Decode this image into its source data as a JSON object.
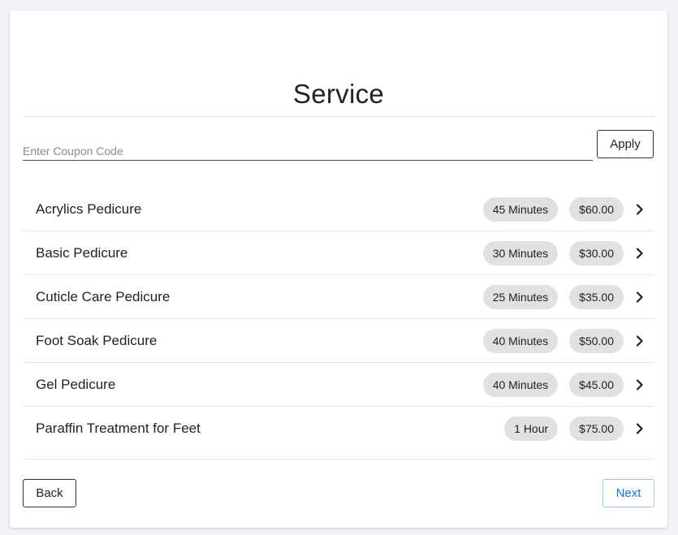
{
  "header": {
    "title": "Service"
  },
  "coupon": {
    "placeholder": "Enter Coupon Code",
    "value": "",
    "apply_label": "Apply"
  },
  "services": [
    {
      "name": "Acrylics Pedicure",
      "duration": "45 Minutes",
      "price": "$60.00"
    },
    {
      "name": "Basic Pedicure",
      "duration": "30 Minutes",
      "price": "$30.00"
    },
    {
      "name": "Cuticle Care Pedicure",
      "duration": "25 Minutes",
      "price": "$35.00"
    },
    {
      "name": "Foot Soak Pedicure",
      "duration": "40 Minutes",
      "price": "$50.00"
    },
    {
      "name": "Gel Pedicure",
      "duration": "40 Minutes",
      "price": "$45.00"
    },
    {
      "name": "Paraffin Treatment for Feet",
      "duration": "1 Hour",
      "price": "$75.00"
    }
  ],
  "footer": {
    "back_label": "Back",
    "next_label": "Next"
  },
  "icons": {
    "row_action": "chevron-right-icon"
  },
  "colors": {
    "accent": "#1a73e8",
    "pill_bg": "#e1e1e1",
    "page_bg": "#f1f3f7"
  }
}
